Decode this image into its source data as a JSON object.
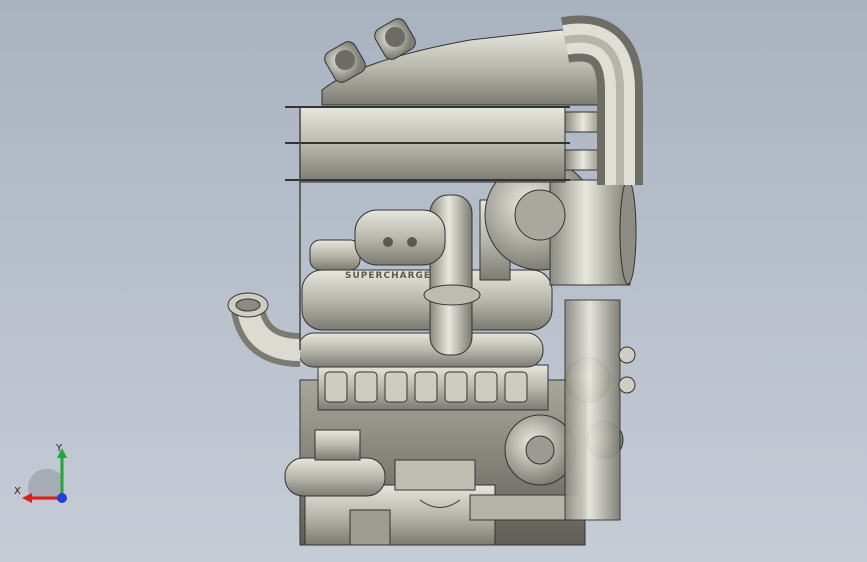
{
  "viewport": {
    "background_top": "#a9b2bf",
    "background_bottom": "#c6ccd6"
  },
  "model": {
    "text_on_valve_cover": "SUPERCHARGER"
  },
  "triad": {
    "x_label": "X",
    "y_label": "Y",
    "x_color": "#d91f1f",
    "y_color": "#22a63a",
    "z_color": "#1f3fd9"
  }
}
